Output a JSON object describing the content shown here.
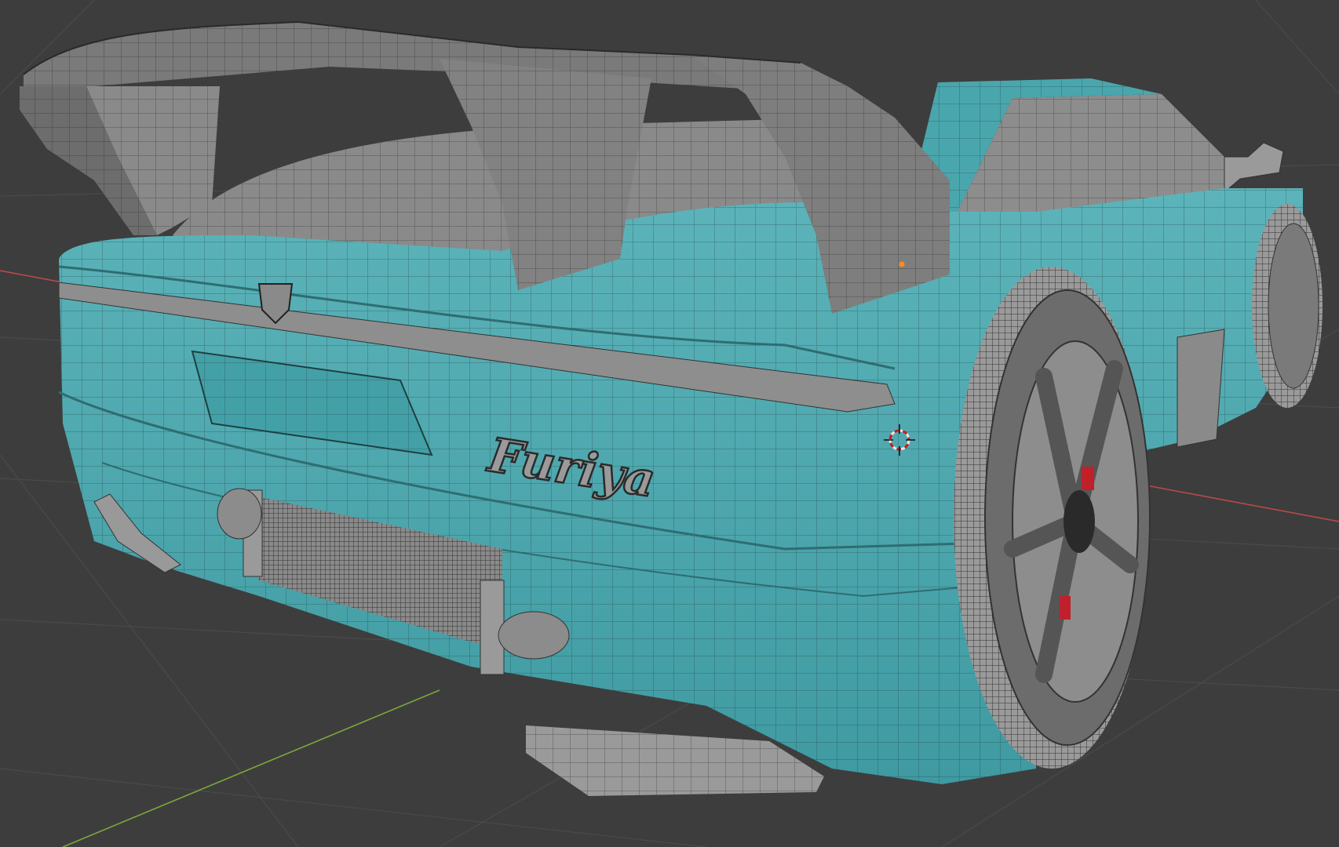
{
  "viewport": {
    "background": "#3d3d3d",
    "grid_color": "#4a4a4a",
    "axis_x_color": "#b84a4a",
    "axis_y_color": "#7aa83a"
  },
  "model": {
    "body_color": "#4aa6ad",
    "body_highlight": "#63bcc2",
    "part_color": "#8a8a8a",
    "dark_part_color": "#555555",
    "wire_color": "#1f3f42",
    "caliper_color": "#c0202a",
    "badge_text": "Furiya"
  },
  "overlays": {
    "origin_color": "#ff8c1a",
    "cursor_icon": "3d-cursor-icon"
  }
}
